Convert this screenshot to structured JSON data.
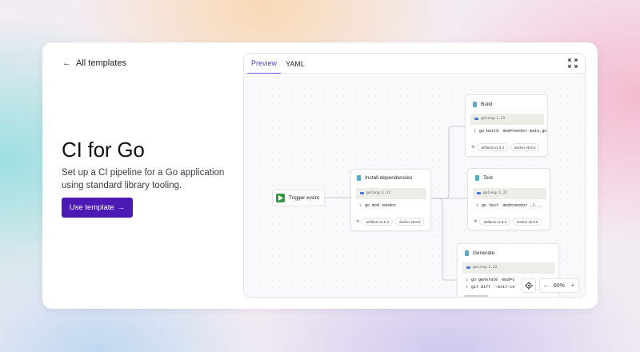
{
  "nav": {
    "back_label": "All templates"
  },
  "hero": {
    "title": "CI for Go",
    "description": "Set up a CI pipeline for a Go application using standard library tooling.",
    "cta_label": "Use template",
    "cta_arrow": "→"
  },
  "panel": {
    "tabs": [
      {
        "label": "Preview",
        "active": true
      },
      {
        "label": "YAML",
        "active": false
      }
    ],
    "expand_icon": "expand-icon"
  },
  "pipeline": {
    "trigger": {
      "label": "Trigger event"
    },
    "nodes": [
      {
        "title": "Install dependencies",
        "image": "golang:1.22",
        "command": "go mod vendor",
        "chips": [
          "artifacts v1.9.3",
          "docker v5.8.0"
        ]
      },
      {
        "title": "Build",
        "image": "golang:1.22",
        "command": "go build -mod=vendor main.go",
        "chips": [
          "artifacts v1.9.3",
          "docker v5.8.0"
        ]
      },
      {
        "title": "Test",
        "image": "golang:1.22",
        "command": "go test -mod=vendor ./...",
        "chips": [
          "artifacts v1.9.3",
          "docker v5.8.0"
        ]
      },
      {
        "title": "Generate",
        "image": "golang:1.22",
        "commands": [
          "go generate -mod=v",
          "git diff --exit-co"
        ]
      }
    ],
    "prompt_symbol": "$"
  },
  "zoom": {
    "level": "60%",
    "minus": "–",
    "plus": "+"
  },
  "colors": {
    "accent": "#4c19b4",
    "tab_active": "#5b3fd0",
    "trigger_green": "#2f9b3f"
  }
}
